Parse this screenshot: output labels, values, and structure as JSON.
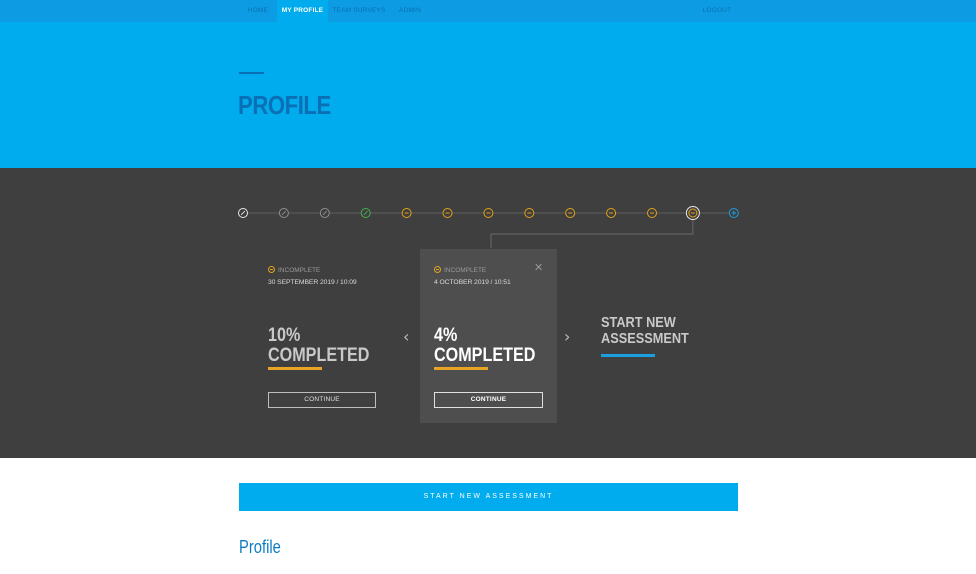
{
  "nav": {
    "items": [
      {
        "label": "HOME",
        "active": false
      },
      {
        "label": "MY PROFILE",
        "active": true
      },
      {
        "label": "TEAM SURVEYS",
        "active": false
      },
      {
        "label": "ADMIN",
        "active": false
      }
    ],
    "logout": "LOGOUT"
  },
  "hero": {
    "title": "PROFILE"
  },
  "timeline": {
    "nodes": [
      {
        "state": "complete-white",
        "icon": "check-circle-icon",
        "color": "#e6e6e6"
      },
      {
        "state": "complete-gray",
        "icon": "check-circle-icon",
        "color": "#8f8f8f"
      },
      {
        "state": "complete-gray",
        "icon": "check-circle-icon",
        "color": "#8f8f8f"
      },
      {
        "state": "complete-green",
        "icon": "check-circle-icon",
        "color": "#45b24a"
      },
      {
        "state": "incomplete",
        "icon": "minus-circle-icon",
        "color": "#e3a21a"
      },
      {
        "state": "incomplete",
        "icon": "minus-circle-icon",
        "color": "#e3a21a"
      },
      {
        "state": "incomplete",
        "icon": "minus-circle-icon",
        "color": "#e3a21a"
      },
      {
        "state": "incomplete",
        "icon": "minus-circle-icon",
        "color": "#e3a21a"
      },
      {
        "state": "incomplete",
        "icon": "minus-circle-icon",
        "color": "#e3a21a"
      },
      {
        "state": "incomplete",
        "icon": "minus-circle-icon",
        "color": "#e3a21a"
      },
      {
        "state": "incomplete",
        "icon": "minus-circle-icon",
        "color": "#e3a21a"
      },
      {
        "state": "selected",
        "icon": "minus-circle-icon",
        "color": "#e3a21a"
      },
      {
        "state": "add",
        "icon": "plus-circle-icon",
        "color": "#1a9fe0"
      }
    ]
  },
  "cards": [
    {
      "status": "INCOMPLETE",
      "datetime": "30 SEPTEMBER 2019 / 10:09",
      "pct_line1": "10%",
      "pct_line2": "COMPLETED",
      "progress": 0.1,
      "button": "CONTINUE"
    },
    {
      "status": "INCOMPLETE",
      "datetime": "4 OCTOBER 2019 / 10:51",
      "pct_line1": "4%",
      "pct_line2": "COMPLETED",
      "progress": 0.04,
      "button": "CONTINUE"
    }
  ],
  "new_assessment": {
    "line1": "START NEW",
    "line2": "ASSESSMENT"
  },
  "start_button": "START NEW ASSESSMENT",
  "profile_section": {
    "title": "Profile"
  },
  "colors": {
    "brand_blue": "#00aced",
    "nav_blue": "#0d9ce3",
    "title_blue": "#0b6fb6",
    "dark_band": "#3f3f3f",
    "card_active": "#4e4e4e",
    "accent_orange": "#e8a425",
    "accent_green": "#45b24a"
  }
}
